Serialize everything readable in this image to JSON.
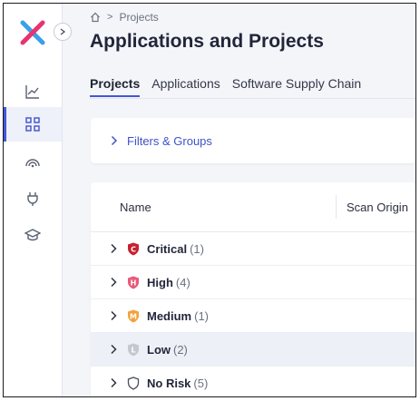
{
  "breadcrumb": {
    "home_icon": "home-icon",
    "separator": ">",
    "current": "Projects"
  },
  "page": {
    "title": "Applications and Projects"
  },
  "tabs": [
    {
      "label": "Projects",
      "active": true
    },
    {
      "label": "Applications",
      "active": false
    },
    {
      "label": "Software Supply Chain",
      "active": false
    }
  ],
  "sidebar": {
    "logo": "x-logo",
    "collapse_icon": "chevron-right-icon",
    "items": [
      {
        "icon": "chart-line-icon",
        "active": false
      },
      {
        "icon": "grid-icon",
        "active": true
      },
      {
        "icon": "radar-icon",
        "active": false
      },
      {
        "icon": "plug-icon",
        "active": false
      },
      {
        "icon": "graduation-cap-icon",
        "active": false
      }
    ]
  },
  "filters": {
    "label": "Filters & Groups"
  },
  "table": {
    "columns": [
      "Name",
      "Scan Origin"
    ],
    "rows": [
      {
        "label": "Critical",
        "count": "(1)",
        "badge": "C",
        "color": "#c8202f"
      },
      {
        "label": "High",
        "count": "(4)",
        "badge": "H",
        "color": "#e85a78"
      },
      {
        "label": "Medium",
        "count": "(1)",
        "badge": "M",
        "color": "#f2a23c"
      },
      {
        "label": "Low",
        "count": "(2)",
        "badge": "L",
        "color": "#c5c8d0",
        "highlighted": true
      },
      {
        "label": "No Risk",
        "count": "(5)",
        "badge": "",
        "color": "#4a4f5e"
      }
    ]
  },
  "colors": {
    "accent": "#4356d6",
    "link": "#3f52c8",
    "logo_pink": "#e8336f",
    "logo_blue": "#3aa0e8"
  }
}
